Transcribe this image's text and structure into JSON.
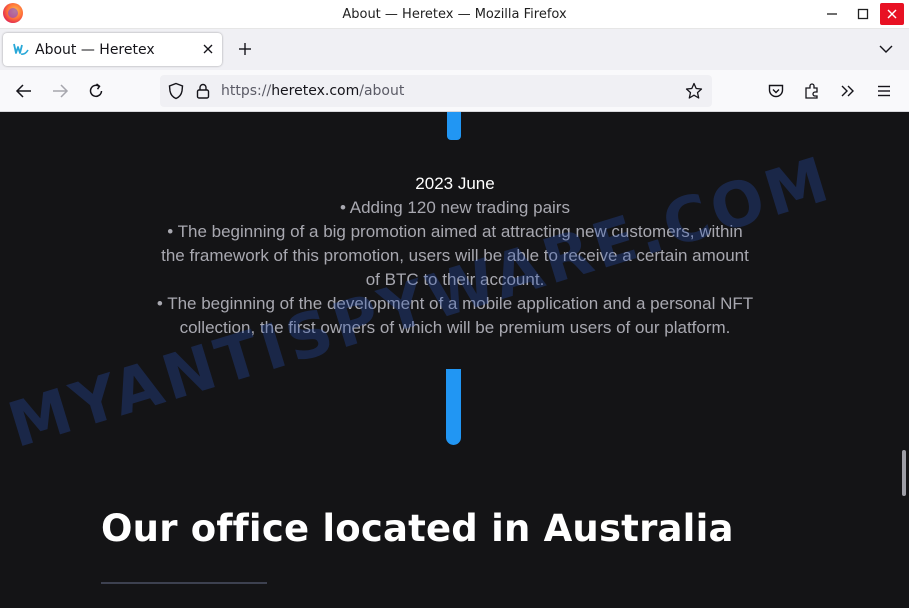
{
  "window": {
    "title": "About — Heretex — Mozilla Firefox",
    "minimize_symbol": "—",
    "maximize_symbol": "☐",
    "close_symbol": "✕"
  },
  "tabs": [
    {
      "title": "About — Heretex",
      "favicon": "heretex-logo-icon",
      "close_symbol": "✕",
      "active": true
    }
  ],
  "tabstrip": {
    "new_tab_symbol": "+"
  },
  "navbar": {
    "url_prefix": "https://",
    "url_host": "heretex.com",
    "url_path": "/about",
    "icons": [
      "back-icon",
      "forward-icon",
      "reload-icon",
      "shield-icon",
      "lock-icon",
      "star-icon",
      "pocket-icon",
      "extensions-icon",
      "overflow-icon",
      "menu-icon"
    ]
  },
  "page": {
    "timeline": {
      "date": "2023 June",
      "lines": [
        "• Adding 120 new trading pairs",
        "• The beginning of a big promotion aimed at attracting new customers, within",
        "the framework of this promotion, users will be able to receive a certain amount",
        "of BTC to their account.",
        "• The beginning of the development of a mobile application and a personal NFT",
        "collection, the first owners of which will be premium users of our platform."
      ]
    },
    "office_heading": "Our office located in Australia",
    "watermark": "MYANTISPYWARE.COM",
    "colors": {
      "background": "#141416",
      "accent": "#2196f3",
      "heading": "#ffffff",
      "body_text": "#a8a8b0"
    }
  }
}
